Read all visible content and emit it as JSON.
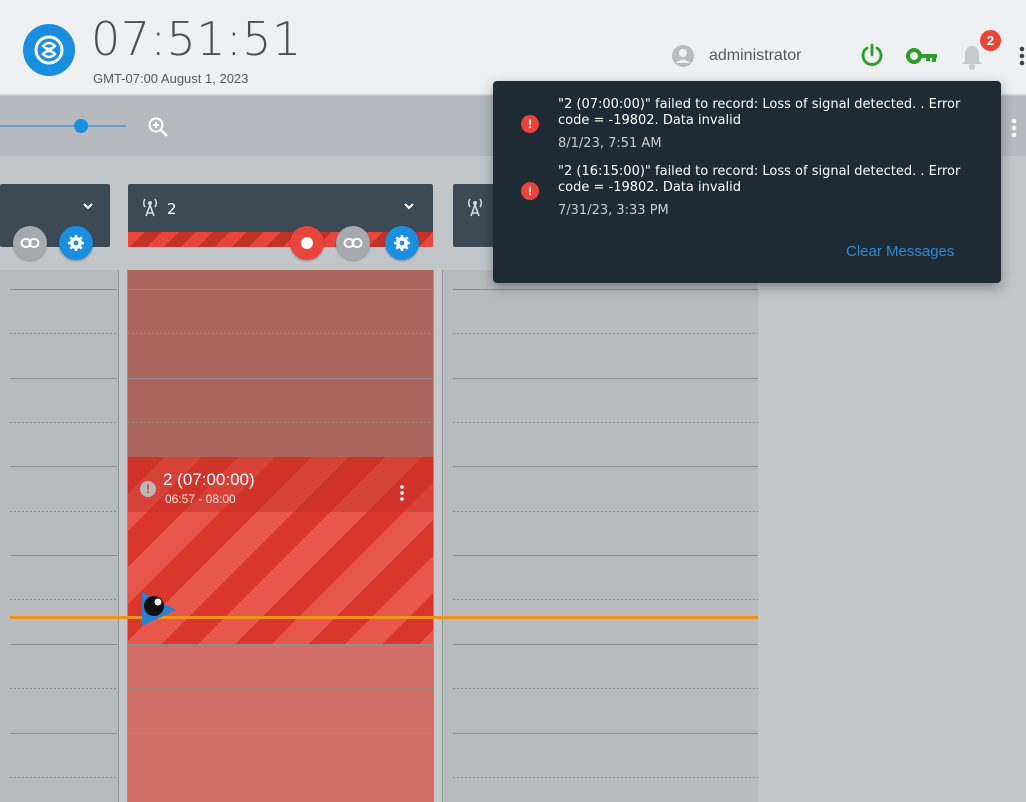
{
  "header": {
    "clock": "07:51:51",
    "date": "GMT-07:00 August 1, 2023",
    "user": "administrator",
    "notification_count": "2"
  },
  "toolbar": {
    "zoom_level": 0.6
  },
  "channels": [
    {
      "name": "",
      "visible": "partial"
    },
    {
      "name": "2",
      "status": "failed"
    },
    {
      "name": "",
      "visible": "partial"
    }
  ],
  "recording": {
    "title": "2 (07:00:00)",
    "time_range": "06:57 - 08:00",
    "status_icon": "error-icon"
  },
  "notifications": {
    "messages": [
      {
        "text": "\"2 (07:00:00)\" failed to record: Loss of signal detected. . Error code = -19802. Data invalid",
        "date": "8/1/23, 7:51 AM"
      },
      {
        "text": "\"2 (16:15:00)\" failed to record: Loss of signal detected. . Error code = -19802. Data invalid",
        "date": "7/31/23, 3:33 PM"
      }
    ],
    "clear_label": "Clear Messages"
  },
  "colors": {
    "accent": "#1a8fe0",
    "error": "#e8443a",
    "now_line": "#f0931c",
    "power_on": "#2a9d2a",
    "popup_bg": "#1e2b35"
  },
  "icons": [
    "logo-icon",
    "user-icon",
    "power-icon",
    "key-icon",
    "bell-icon",
    "more-vert-icon",
    "zoom-in-icon",
    "antenna-icon",
    "chevron-down-icon",
    "link-icon",
    "gear-icon",
    "record-icon",
    "error-icon",
    "cursor-icon"
  ]
}
